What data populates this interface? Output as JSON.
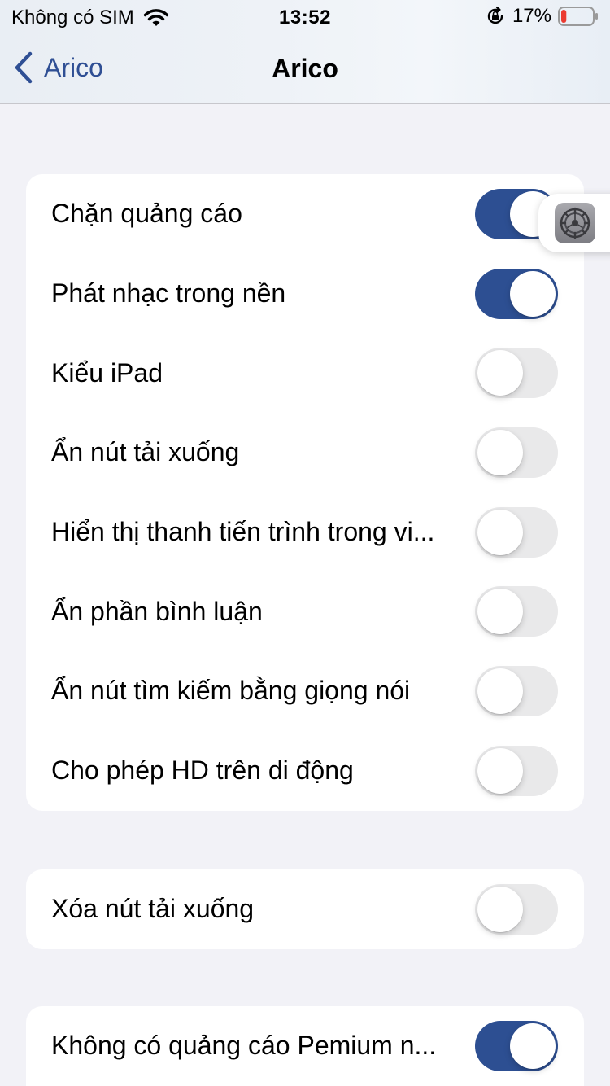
{
  "status_bar": {
    "carrier": "Không có SIM",
    "time": "13:52",
    "battery": "17%",
    "battery_level": 0.17,
    "icons": [
      "wifi-icon",
      "orientation-lock-icon",
      "battery-icon"
    ]
  },
  "nav": {
    "back_label": "Arico",
    "title": "Arico"
  },
  "groups": [
    {
      "rows": [
        {
          "label": "Chặn quảng cáo",
          "on": true
        },
        {
          "label": "Phát nhạc trong nền",
          "on": true
        },
        {
          "label": "Kiểu iPad",
          "on": false
        },
        {
          "label": "Ẩn nút tải xuống",
          "on": false
        },
        {
          "label": "Hiển thị thanh tiến trình trong vi...",
          "on": false
        },
        {
          "label": "Ẩn phần bình luận",
          "on": false
        },
        {
          "label": "Ẩn nút tìm kiếm bằng giọng nói",
          "on": false
        },
        {
          "label": "Cho phép HD trên di động",
          "on": false
        }
      ]
    },
    {
      "rows": [
        {
          "label": "Xóa nút tải xuống",
          "on": false
        }
      ]
    },
    {
      "rows": [
        {
          "label": "Không có quảng cáo Pemium n...",
          "on": true
        }
      ]
    }
  ],
  "colors": {
    "accent": "#2d4f92",
    "toggle_off": "#e9e9ea",
    "background": "#f2f2f7"
  },
  "floating_button": {
    "icon": "settings-gear-icon"
  }
}
